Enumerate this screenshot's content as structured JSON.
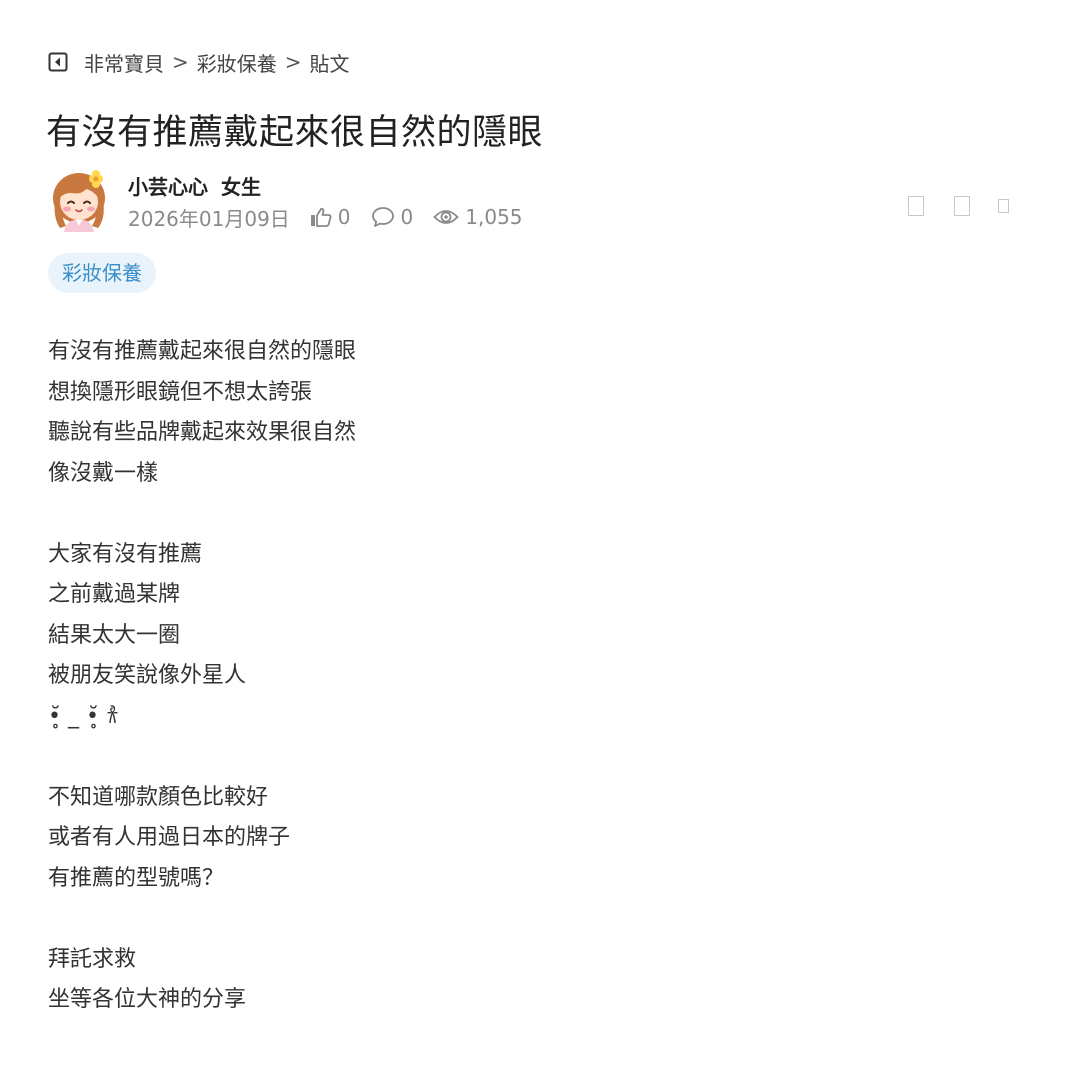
{
  "breadcrumb": {
    "items": [
      "非常寶貝",
      "彩妝保養",
      "貼文"
    ],
    "separator": ">"
  },
  "post": {
    "title": "有沒有推薦戴起來很自然的隱眼",
    "author": {
      "name": "小芸心心",
      "gender": "女生"
    },
    "date": "2026年01月09日",
    "likes": "0",
    "comments": "0",
    "views": "1,055",
    "tag": "彩妝保養",
    "body_lines": [
      "有沒有推薦戴起來很自然的隱眼",
      "想換隱形眼鏡但不想太誇張",
      "聽說有些品牌戴起來效果很自然",
      "像沒戴一樣",
      "",
      "大家有沒有推薦",
      "之前戴過某牌",
      "結果太大一圈",
      "被朋友笑說像外星人",
      "•̥̆ _ •̥̆ 𐀪",
      "",
      "不知道哪款顏色比較好",
      "或者有人用過日本的牌子",
      "有推薦的型號嗎？",
      "",
      "拜託求救",
      "坐等各位大神的分享"
    ]
  },
  "colors": {
    "tag_bg": "#e8f3fb",
    "tag_text": "#3a8fc8",
    "meta_text": "#8a8a8a",
    "title_text": "#222222"
  },
  "icons": {
    "back": "back-arrow-square-icon",
    "like": "thumbs-up-icon",
    "comment": "comment-bubble-icon",
    "views": "eye-icon"
  }
}
